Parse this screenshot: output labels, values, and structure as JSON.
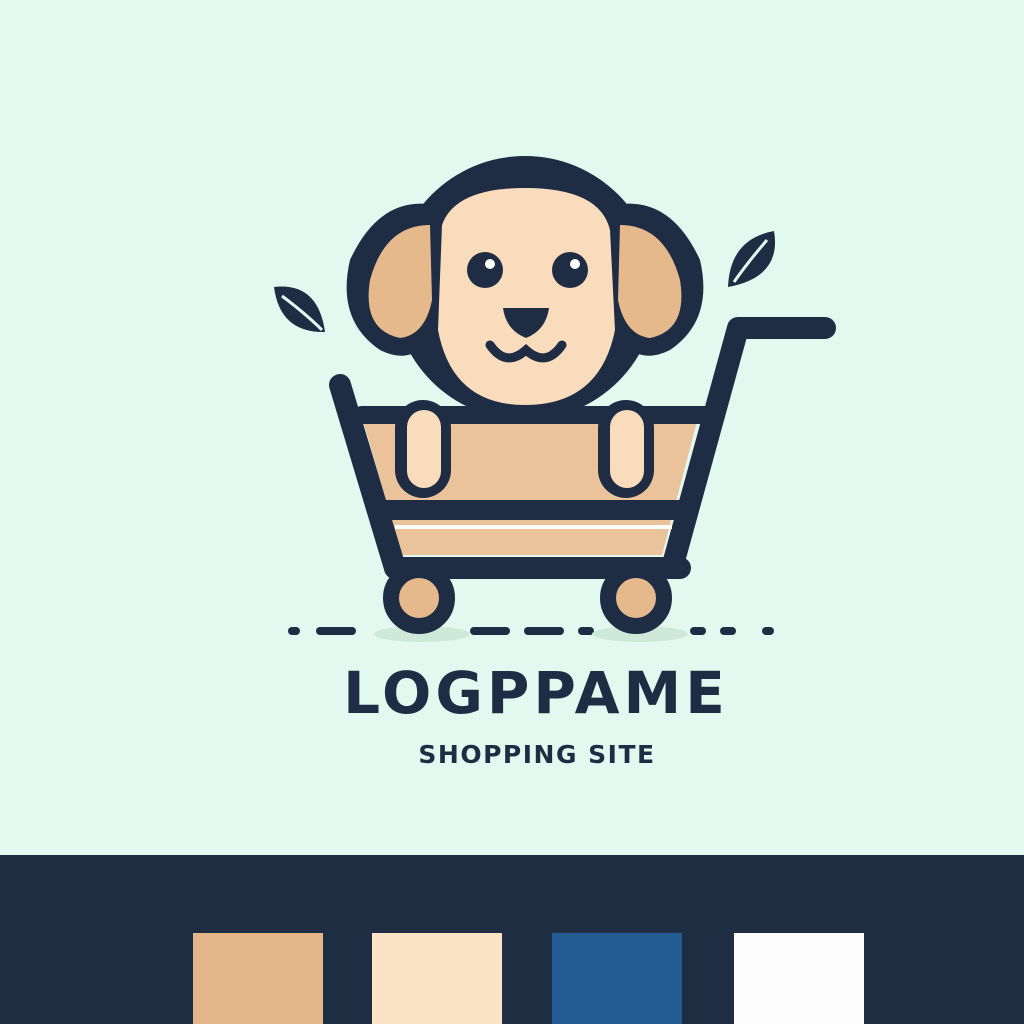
{
  "brand": {
    "name": "LOGPPAME",
    "tagline": "SHOPPING SITE"
  },
  "colors": {
    "background": "#e3f8ee",
    "outline": "#1f2d44",
    "dog_face": "#f8dcbb",
    "dog_ear": "#e6b98d",
    "cart_fill": "#eac39a",
    "shadow": "#cfe9d9"
  },
  "logo": {
    "subject": "dog sitting in a shopping cart",
    "icons": [
      "dog-icon",
      "shopping-cart-icon",
      "leaf-icon",
      "leaf-icon"
    ]
  },
  "palette": {
    "swatches": [
      {
        "name": "tan",
        "color": "#e4b78b"
      },
      {
        "name": "cream",
        "color": "#fbe3c5"
      },
      {
        "name": "blue",
        "color": "#225c92"
      },
      {
        "name": "white",
        "color": "#fdfdfd"
      }
    ]
  }
}
